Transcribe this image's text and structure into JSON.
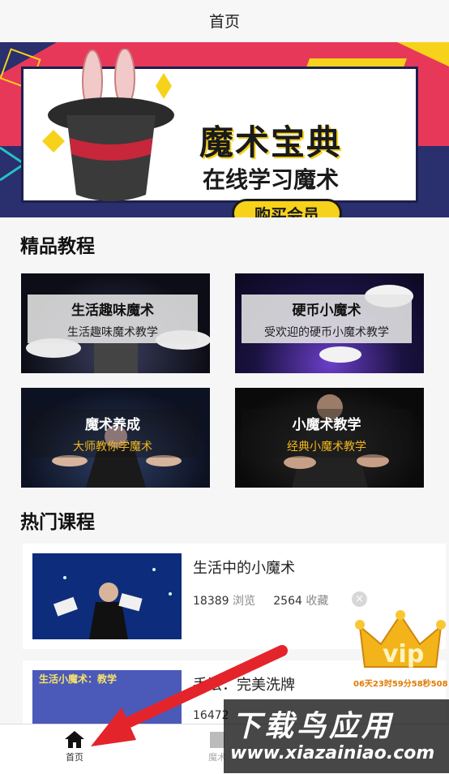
{
  "header": {
    "title": "首页"
  },
  "banner": {
    "headline": "魔术宝典",
    "subline": "在线学习魔术",
    "button": "购买会员",
    "active_slide": 1,
    "slide_count": 4
  },
  "tutorials": {
    "title": "精品教程",
    "items": [
      {
        "title": "生活趣味魔术",
        "subtitle": "生活趣味魔术教学"
      },
      {
        "title": "硬币小魔术",
        "subtitle": "受欢迎的硬币小魔术教学"
      },
      {
        "title": "魔术养成",
        "subtitle": "大师教你学魔术"
      },
      {
        "title": "小魔术教学",
        "subtitle": "经典小魔术教学"
      }
    ]
  },
  "hot": {
    "title": "热门课程",
    "courses": [
      {
        "name": "生活中的小魔术",
        "views": "18389",
        "views_label": "浏览",
        "favs": "2564",
        "favs_label": "收藏",
        "close": "×"
      },
      {
        "name": "手法：完美洗牌",
        "views": "16472",
        "views_label": "",
        "favs": "",
        "favs_label": "",
        "close": "",
        "thumb_text": "生活小魔术：教学"
      }
    ]
  },
  "vip": {
    "label": "vip",
    "countdown": "06天23时59分58秒508"
  },
  "tabbar": {
    "items": [
      {
        "label": "首页",
        "icon": "home-icon"
      },
      {
        "label": "魔术",
        "icon": "book-icon"
      }
    ]
  },
  "watermark": {
    "line1": "下载鸟应用",
    "line2": "www.xiazainiao.com"
  },
  "colors": {
    "banner_red": "#e8385a",
    "banner_yellow": "#f7d21b",
    "navy": "#2a2f6d",
    "accent_orange": "#f2b71d",
    "arrow": "#e3242b"
  }
}
